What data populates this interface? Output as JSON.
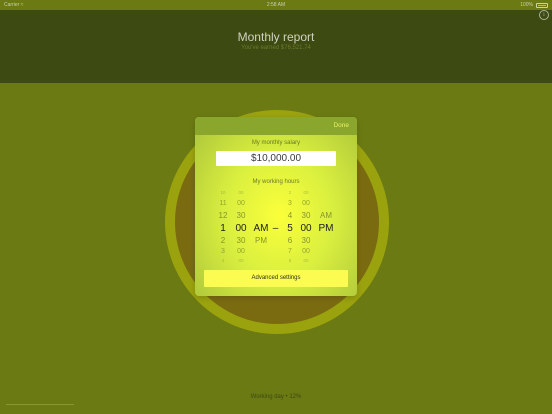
{
  "status_bar": {
    "carrier": "Carrier",
    "time": "2:58 AM",
    "battery": "100%",
    "battery_level": 1.0
  },
  "header": {
    "title": "Monthly report",
    "subtitle": "You've earned $76,521.74"
  },
  "popup": {
    "done_label": "Done",
    "salary_label": "My monthly salary",
    "salary_value": "$10,000.00",
    "hours_label": "My working hours",
    "start_picker": {
      "hours": [
        "10",
        "11",
        "12",
        "1",
        "2",
        "3",
        "4"
      ],
      "minutes": [
        "00",
        "00",
        "30",
        "00",
        "30",
        "00",
        "00"
      ],
      "period": [
        "",
        "",
        "",
        "AM",
        "PM",
        "",
        ""
      ]
    },
    "separator": "–",
    "end_picker": {
      "hours": [
        "2",
        "3",
        "4",
        "5",
        "6",
        "7",
        "8"
      ],
      "minutes": [
        "00",
        "00",
        "30",
        "00",
        "30",
        "00",
        "00"
      ],
      "period": [
        "",
        "",
        "AM",
        "PM",
        "",
        "",
        ""
      ]
    },
    "advanced_label": "Advanced settings"
  },
  "footer": {
    "status_text": "Working day • 12%",
    "progress": 0.12
  },
  "colors": {
    "background": "#6b7a12",
    "header": "#3d4a12",
    "circle_ring": "#9aa20e",
    "circle_fill": "#7a6b11",
    "popup_bar": "#8aa62c",
    "advanced_button": "#fbfb52",
    "battery_fill": "#7ee04b"
  },
  "icons": {
    "info": "info-icon",
    "wifi": "wifi-icon",
    "battery": "battery-icon"
  }
}
